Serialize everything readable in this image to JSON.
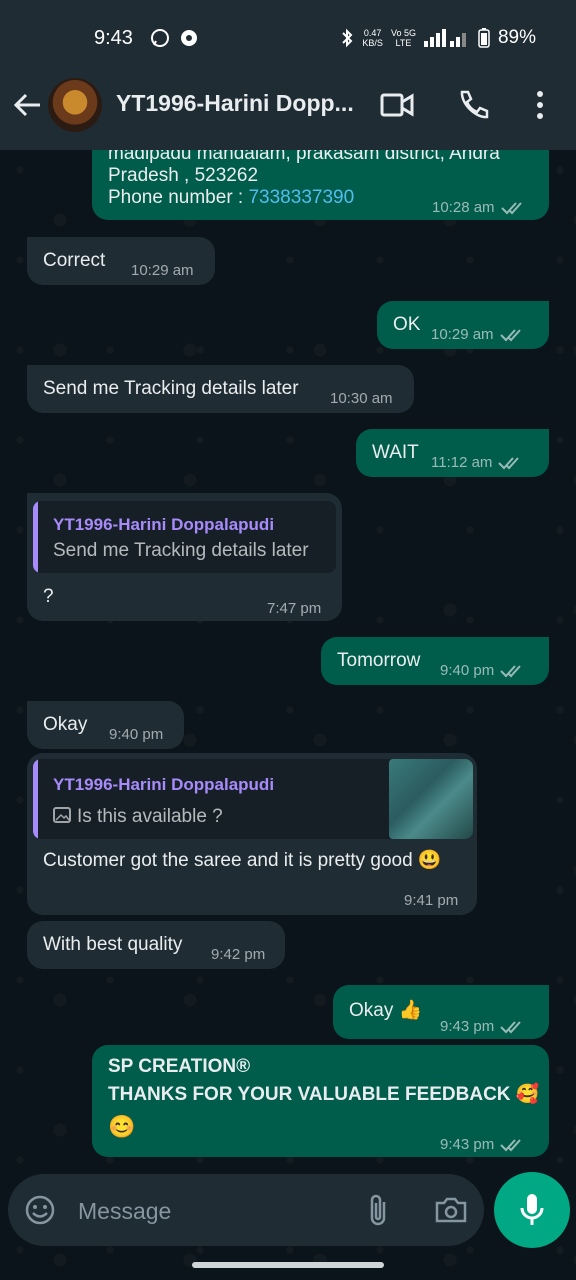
{
  "status": {
    "time": "9:43",
    "data_speed_value": "0.47",
    "data_speed_unit": "KB/S",
    "network_top": "Vo 5G",
    "network_bottom": "LTE",
    "battery": "89%"
  },
  "header": {
    "contact_name": "YT1996-Harini Dopp..."
  },
  "messages": {
    "m0": {
      "text_line1": "madipadu mandalam, prakasam district, Andra",
      "text_line2": "Pradesh , 523262",
      "phone_label": "Phone number : ",
      "phone": "7338337390",
      "time": "10:28 am"
    },
    "m1": {
      "text": "Correct",
      "time": "10:29 am"
    },
    "m2": {
      "text": "OK",
      "time": "10:29 am"
    },
    "m3": {
      "text": "Send me Tracking details later",
      "time": "10:30 am"
    },
    "m4": {
      "text": "WAIT",
      "time": "11:12 am"
    },
    "m5": {
      "quote_author": "YT1996-Harini Doppalapudi",
      "quote_text": "Send me Tracking details later",
      "text": "?",
      "time": "7:47 pm"
    },
    "m6": {
      "text": "Tomorrow",
      "time": "9:40 pm"
    },
    "m7": {
      "text": "Okay",
      "time": "9:40 pm"
    },
    "m8": {
      "quote_author": "YT1996-Harini Doppalapudi",
      "quote_text": "Is this available ?",
      "text": "Customer got the saree and it is pretty good 😃",
      "time": "9:41 pm"
    },
    "m9": {
      "text": "With best quality",
      "time": "9:42 pm"
    },
    "m10": {
      "text": "Okay 👍",
      "time": "9:43 pm"
    },
    "m11": {
      "line1": "SP CREATION®",
      "line2": "THANKS FOR YOUR VALUABLE FEEDBACK 🥰",
      "line3": "😊",
      "time": "9:43 pm"
    }
  },
  "input": {
    "placeholder": "Message"
  },
  "colors": {
    "outgoing": "#005c4b",
    "incoming": "#1f2c34",
    "accent": "#00a884",
    "quote_author": "#a78bfa",
    "link": "#53bdeb"
  }
}
